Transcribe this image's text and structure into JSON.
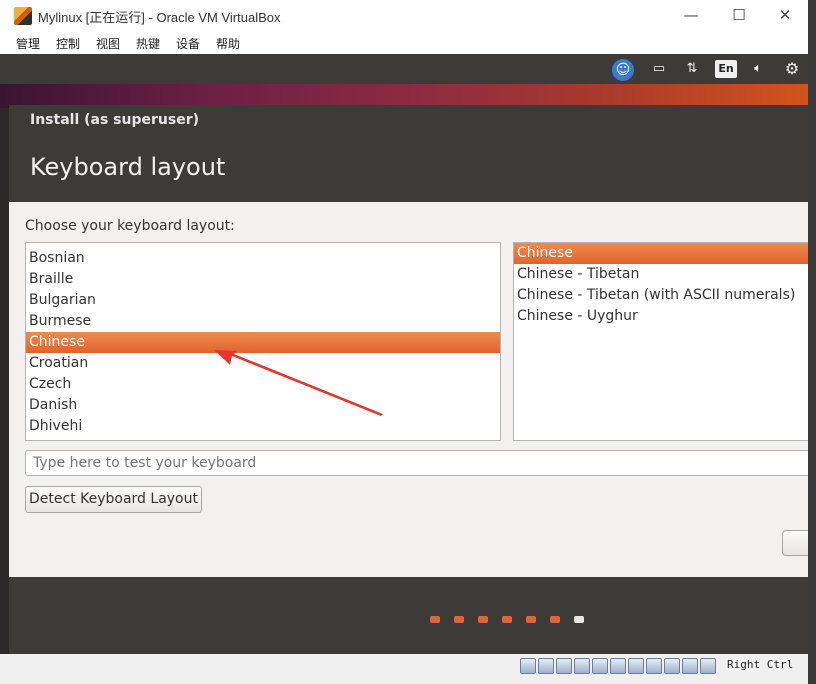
{
  "window": {
    "title": "Mylinux [正在运行] - Oracle VM VirtualBox",
    "controls": {
      "minimize": "—",
      "maximize": "☐",
      "close": "✕"
    }
  },
  "menu": {
    "items": [
      "管理",
      "控制",
      "视图",
      "热键",
      "设备",
      "帮助"
    ]
  },
  "topbar": {
    "accessibility_icon": "accessibility-icon",
    "battery_icon": "battery-icon",
    "network_icon": "network-arrows-icon",
    "language": "En",
    "volume_icon": "volume-icon",
    "settings_icon": "gear-icon"
  },
  "installer": {
    "window_title": "Install (as superuser)",
    "heading": "Keyboard layout",
    "prompt": "Choose your keyboard layout:",
    "layouts": [
      "Bosnian",
      "Braille",
      "Bulgarian",
      "Burmese",
      "Chinese",
      "Croatian",
      "Czech",
      "Danish",
      "Dhivehi"
    ],
    "selected_layout": "Chinese",
    "variants": [
      "Chinese",
      "Chinese - Tibetan",
      "Chinese - Tibetan (with ASCII numerals)",
      "Chinese - Uyghur"
    ],
    "selected_variant": "Chinese",
    "test_placeholder": "Type here to test your keyboard",
    "detect_button": "Detect Keyboard Layout",
    "progress": {
      "total_steps": 7,
      "current_step": 7
    }
  },
  "statusbar": {
    "host_key": "Right Ctrl",
    "icons": [
      "hard-disk-icon",
      "optical-drive-icon",
      "audio-icon",
      "network-icon",
      "usb-icon",
      "shared-folders-icon",
      "display-icon",
      "video-capture-icon",
      "virtualization-icon",
      "cpu-icon",
      "mouse-integration-icon",
      "keyboard-icon"
    ]
  },
  "colors": {
    "accent_orange": "#e0632c",
    "dark_panel": "#3c3b37",
    "annotation_arrow": "#e8342a"
  }
}
